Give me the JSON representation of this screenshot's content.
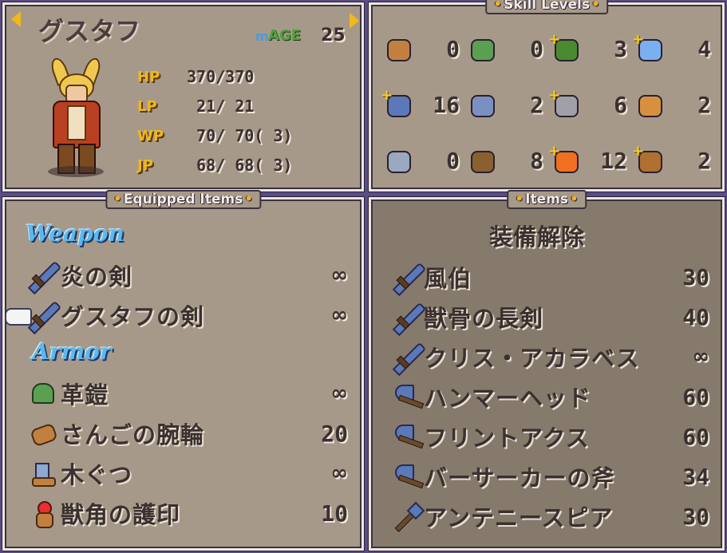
{
  "character": {
    "name": "グスタフ",
    "age_label": "AGE",
    "age_value": "25",
    "stats": [
      {
        "label": "HP",
        "value": "370/370"
      },
      {
        "label": "LP",
        "value": " 21/ 21"
      },
      {
        "label": "WP",
        "value": " 70/ 70( 3)"
      },
      {
        "label": "JP",
        "value": " 68/ 68( 3)"
      }
    ]
  },
  "skill_panel": {
    "title": "Skill Levels",
    "skills": [
      {
        "icon": "bag-icon",
        "value": "0",
        "plus": false
      },
      {
        "icon": "staff-icon",
        "value": "0",
        "plus": false
      },
      {
        "icon": "tree-icon",
        "value": "3",
        "plus": true
      },
      {
        "icon": "water-icon",
        "value": "4",
        "plus": true
      },
      {
        "icon": "sword-icon",
        "value": "16",
        "plus": true
      },
      {
        "icon": "axe-icon",
        "value": "2",
        "plus": false
      },
      {
        "icon": "stone-icon",
        "value": "6",
        "plus": true
      },
      {
        "icon": "music-icon",
        "value": "2",
        "plus": false
      },
      {
        "icon": "hammer-icon",
        "value": "0",
        "plus": false
      },
      {
        "icon": "bow-icon",
        "value": "8",
        "plus": false
      },
      {
        "icon": "fire-icon",
        "value": "12",
        "plus": true
      },
      {
        "icon": "beast-icon",
        "value": "2",
        "plus": true
      }
    ]
  },
  "equipped": {
    "title": "Equipped Items",
    "weapon_label": "Weapon",
    "armor_label": "Armor",
    "weapons": [
      {
        "icon": "sword-icon",
        "name": "炎の剣",
        "count": "∞"
      },
      {
        "icon": "sword-icon",
        "name": "グスタフの剣",
        "count": "∞"
      }
    ],
    "armor": [
      {
        "icon": "helmet-icon",
        "name": "革鎧",
        "count": "∞"
      },
      {
        "icon": "bracelet-icon",
        "name": "さんごの腕輪",
        "count": "20"
      },
      {
        "icon": "boots-icon",
        "name": "木ぐつ",
        "count": "∞"
      },
      {
        "icon": "amulet-icon",
        "name": "獣角の護印",
        "count": "10"
      }
    ]
  },
  "items": {
    "title": "Items",
    "unequip_label": "装備解除",
    "list": [
      {
        "icon": "sword-icon",
        "name": "風伯",
        "count": "30"
      },
      {
        "icon": "sword-icon",
        "name": "獣骨の長剣",
        "count": "40"
      },
      {
        "icon": "sword-icon",
        "name": "クリス・アカラベス",
        "count": "∞"
      },
      {
        "icon": "axe-icon",
        "name": "ハンマーヘッド",
        "count": "60"
      },
      {
        "icon": "axe-icon",
        "name": "フリントアクス",
        "count": "60"
      },
      {
        "icon": "axe-icon",
        "name": "バーサーカーの斧",
        "count": "34"
      },
      {
        "icon": "spear-icon",
        "name": "アンテニースピア",
        "count": "30"
      }
    ]
  }
}
